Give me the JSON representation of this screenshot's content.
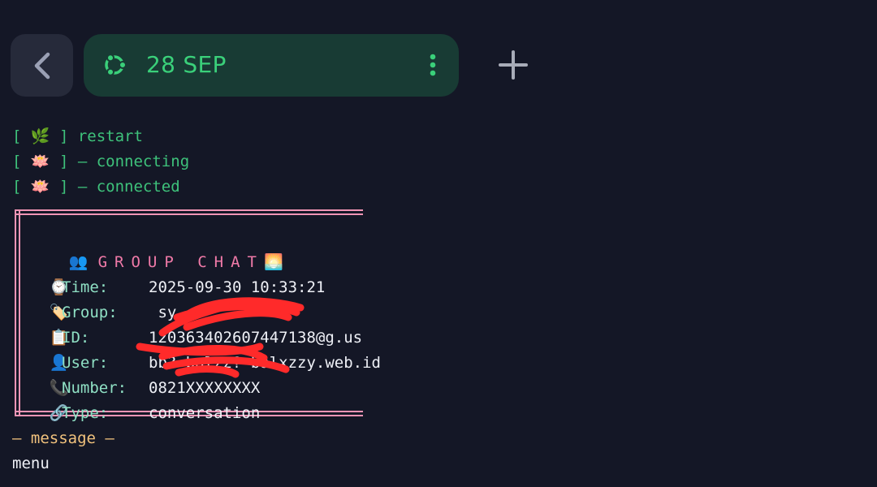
{
  "tab": {
    "title": "28 SEP"
  },
  "log": [
    {
      "prefix": "[ 🌿 ] ",
      "text": "restart"
    },
    {
      "prefix": "[ 🪷 ] ",
      "text": "— connecting"
    },
    {
      "prefix": "[ 🪷 ] ",
      "text": "— connected"
    }
  ],
  "card": {
    "heading_icon": "👥",
    "heading": "GROUP CHAT",
    "heading_emoji": "🌅",
    "rows": [
      {
        "icon": "⌚",
        "label": "Time:",
        "value": "2025-09-30 10:33:21"
      },
      {
        "icon": "🏷️",
        "label": "Group:",
        "value": " sy"
      },
      {
        "icon": "📋",
        "label": "ID:",
        "value": "120363402607447138@g.us"
      },
      {
        "icon": "👤",
        "label": "User:",
        "value": "bb? balzz?—balxzzy.web.id"
      },
      {
        "icon": "📞",
        "label": "Number:",
        "value": "0821XXXXXXXX"
      },
      {
        "icon": "🔗",
        "label": "Type:",
        "value": "conversation"
      }
    ]
  },
  "message_header": "— message —",
  "message_text": "menu",
  "colors": {
    "background": "#141726",
    "tab_bg": "#183b34",
    "accent_green": "#3ad07a",
    "frame_pink": "#f095b5",
    "redaction_red": "#ff2a2a"
  }
}
